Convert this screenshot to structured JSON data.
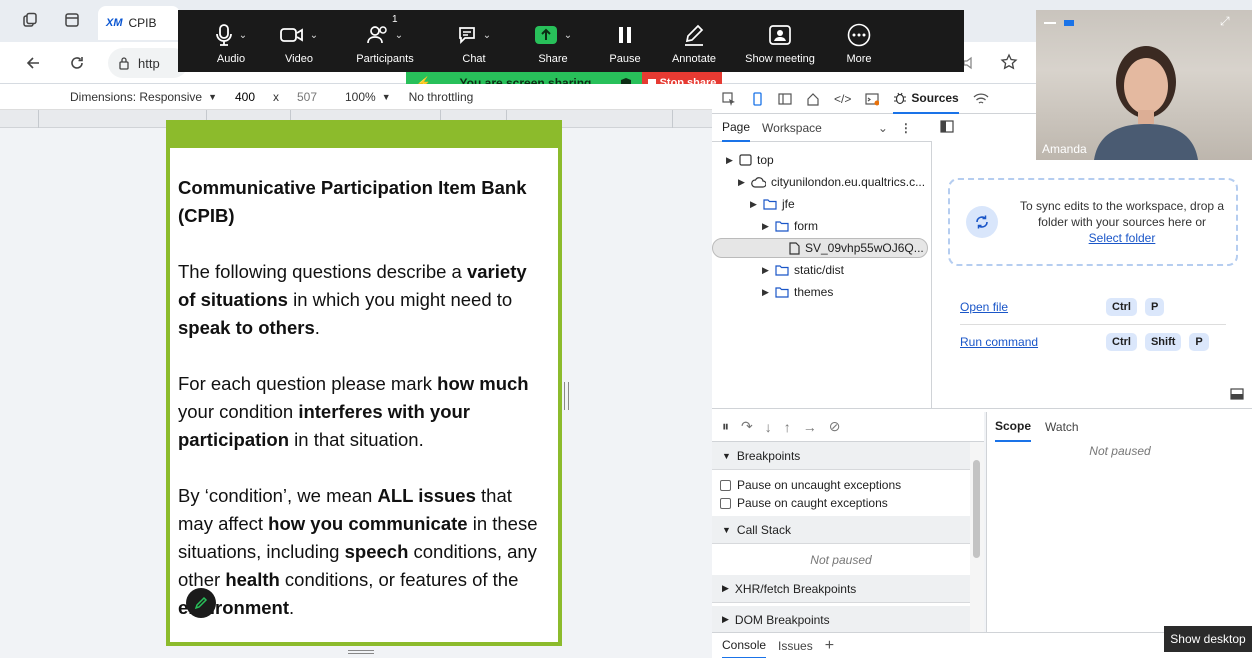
{
  "browser": {
    "tab_title": "CPIB",
    "tab_favicon": "XM",
    "url_fragment": "http"
  },
  "zoom_toolbar": {
    "audio": "Audio",
    "video": "Video",
    "participants": "Participants",
    "participants_count": "1",
    "chat": "Chat",
    "share": "Share",
    "pause": "Pause",
    "annotate": "Annotate",
    "show_meeting": "Show meeting",
    "more": "More",
    "sharing_status": "You are screen sharing",
    "stop_share": "Stop share"
  },
  "device_toolbar": {
    "dimensions": "Dimensions: Responsive",
    "width": "400",
    "times": "x",
    "height": "507",
    "zoom": "100%",
    "throttling": "No throttling"
  },
  "survey": {
    "title": "Communicative Participation Item Bank (CPIB)",
    "p1_a": "The following questions describe a ",
    "p1_b": "variety of situations",
    "p1_c": " in which you might need to ",
    "p1_d": "speak to others",
    "p1_e": ".",
    "p2_a": "For each question please mark ",
    "p2_b": "how much",
    "p2_c": " your condition ",
    "p2_d": "interferes with your participation",
    "p2_e": " in that situation.",
    "p3_a": "By ‘condition’, we mean ",
    "p3_b": "ALL issues",
    "p3_c": " that may affect ",
    "p3_d": "how you communicate",
    "p3_e": " in these situations, including ",
    "p3_f": "speech",
    "p3_g": " conditions, any other ",
    "p3_h": "health",
    "p3_i": " conditions, or features of the ",
    "p3_j": "environment",
    "p3_k": "."
  },
  "devtools": {
    "sources_tab": "Sources",
    "navigator_tabs": [
      "Page",
      "Workspace"
    ],
    "tree": [
      {
        "label": "top"
      },
      {
        "label": "cityunilondon.eu.qualtrics.c..."
      },
      {
        "label": "jfe"
      },
      {
        "label": "form"
      },
      {
        "label": "SV_09vhp55wOJ6Q..."
      },
      {
        "label": "static/dist"
      },
      {
        "label": "themes"
      }
    ],
    "workspace_hint": "To sync edits to the workspace, drop a folder with your sources here or",
    "select_folder": "Select folder",
    "open_file": "Open file",
    "run_command": "Run command",
    "kbd_ctrl": "Ctrl",
    "kbd_shift": "Shift",
    "kbd_p": "P",
    "scope_tab": "Scope",
    "watch_tab": "Watch",
    "not_paused": "Not paused",
    "breakpoints": "Breakpoints",
    "pause_uncaught": "Pause on uncaught exceptions",
    "pause_caught": "Pause on caught exceptions",
    "call_stack": "Call Stack",
    "xhr_breakpoints": "XHR/fetch Breakpoints",
    "dom_breakpoints": "DOM Breakpoints",
    "console_tab": "Console",
    "issues_tab": "Issues"
  },
  "video_tile": {
    "participant_name": "Amanda"
  },
  "taskbar": {
    "show_desktop": "Show desktop"
  },
  "colors": {
    "accent": "#1a73e8",
    "share_green": "#28c05a",
    "stop_red": "#e63a32",
    "survey_border": "#8cbb2c"
  }
}
